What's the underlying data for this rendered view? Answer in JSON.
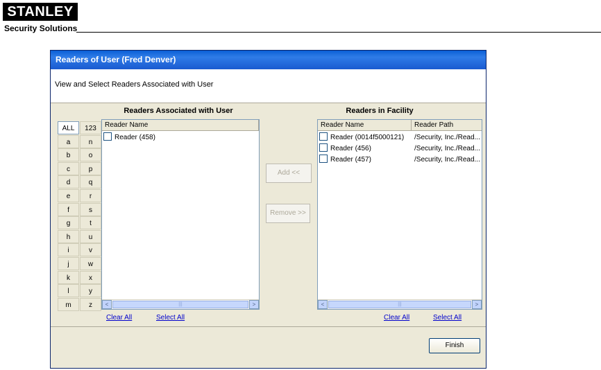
{
  "brand": {
    "logo_text": "STANLEY",
    "tagline": "Security Solutions"
  },
  "dialog": {
    "title": "Readers of User (Fred Denver)",
    "banner_text": "View and Select Readers Associated with User",
    "left_panel": {
      "title": "Readers Associated with User",
      "column_header": "Reader Name",
      "rows": [
        {
          "name": "Reader (458)"
        }
      ],
      "clear_all": "Clear All",
      "select_all": "Select All"
    },
    "right_panel": {
      "title": "Readers in Facility",
      "column_headers": [
        "Reader Name",
        "Reader Path"
      ],
      "rows": [
        {
          "name": "Reader (0014f5000121)",
          "path": "/Security, Inc./Read..."
        },
        {
          "name": "Reader (456)",
          "path": "/Security, Inc./Read..."
        },
        {
          "name": "Reader (457)",
          "path": "/Security, Inc./Read..."
        }
      ],
      "clear_all": "Clear All",
      "select_all": "Select All"
    },
    "alphabet": {
      "left": [
        "ALL",
        "a",
        "b",
        "c",
        "d",
        "e",
        "f",
        "g",
        "h",
        "i",
        "j",
        "k",
        "l",
        "m"
      ],
      "right": [
        "123",
        "n",
        "o",
        "p",
        "q",
        "r",
        "s",
        "t",
        "u",
        "v",
        "w",
        "x",
        "y",
        "z"
      ],
      "selected": "ALL"
    },
    "buttons": {
      "add": "Add   <<",
      "remove": "Remove >>",
      "finish": "Finish"
    },
    "scroll": {
      "left_arrow": "<",
      "right_arrow": ">",
      "grip": "|||"
    }
  }
}
